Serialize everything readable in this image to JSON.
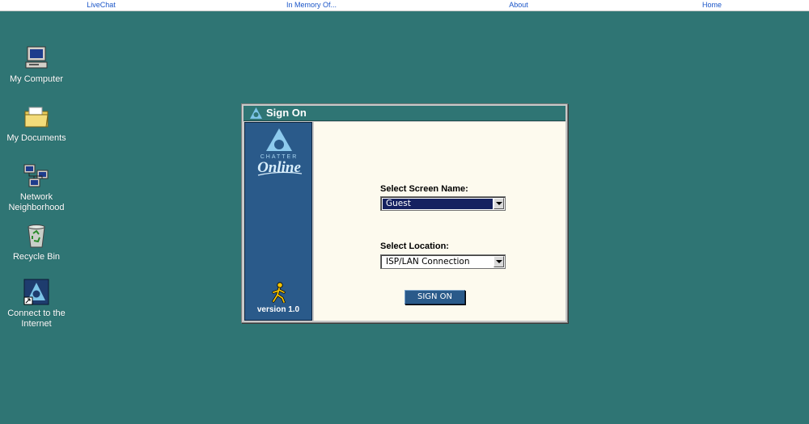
{
  "topnav": {
    "links": [
      "LiveChat",
      "In Memory Of...",
      "About",
      "Home"
    ]
  },
  "desktop": {
    "icons": [
      {
        "label": "My Computer",
        "icon": "computer-icon"
      },
      {
        "label": "My Documents",
        "icon": "folder-icon"
      },
      {
        "label": "Network Neighborhood",
        "icon": "network-icon"
      },
      {
        "label": "Recycle Bin",
        "icon": "recycle-bin-icon"
      },
      {
        "label": "Connect to the Internet",
        "icon": "chatter-online-shortcut-icon"
      }
    ]
  },
  "window": {
    "title": "Sign On",
    "logo_text_top": "CHATTER",
    "logo_text_main": "Online",
    "version": "version 1.0",
    "screen_name_label": "Select Screen Name:",
    "screen_name_value": "Guest",
    "location_label": "Select Location:",
    "location_value": "ISP/LAN Connection",
    "signon_label": "SIGN ON"
  },
  "colors": {
    "desktop": "#2f7574",
    "panel_blue": "#2a5a8a",
    "content_bg": "#fdfaee",
    "selected_field": "#152160"
  }
}
